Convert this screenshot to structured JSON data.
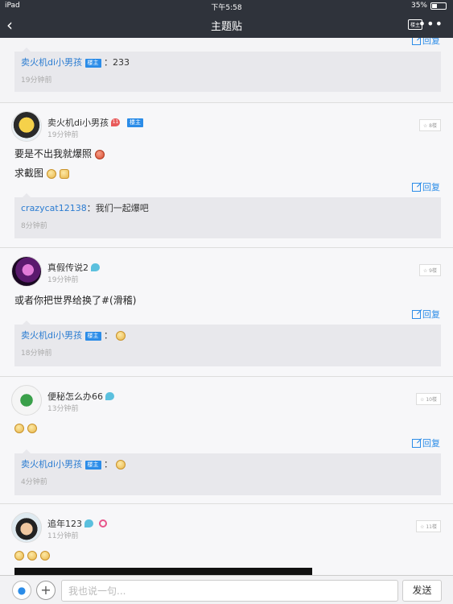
{
  "status": {
    "device": "iPad",
    "time": "下午5:58",
    "battery": "35%"
  },
  "nav": {
    "title": "主题贴",
    "louzhu": "楼主",
    "more": "•••",
    "back": "‹"
  },
  "reply_label": "回复",
  "top_sub": {
    "user": "卖火机di小男孩",
    "badge": "楼主",
    "text": "：233",
    "time": "19分钟前"
  },
  "posts": [
    {
      "user": "卖火机di小男孩",
      "level": "11",
      "badge": "楼主",
      "time": "19分钟前",
      "floor": "8楼",
      "lines": [
        "要是不出我就爆照",
        "求截图"
      ],
      "sub": {
        "user": "crazycat12138",
        "text": "：我们一起爆吧",
        "time": "8分钟前"
      }
    },
    {
      "user": "真假传说2",
      "level": "",
      "time": "19分钟前",
      "floor": "9楼",
      "lines": [
        "或者你把世界给换了#(滑稽)"
      ],
      "sub": {
        "user": "卖火机di小男孩",
        "badge": "楼主",
        "text": "：",
        "time": "18分钟前"
      }
    },
    {
      "user": "便秘怎么办66",
      "level": "",
      "time": "13分钟前",
      "floor": "10楼",
      "lines": [
        ""
      ],
      "sub": {
        "user": "卖火机di小男孩",
        "badge": "楼主",
        "text": "：",
        "time": "4分钟前"
      }
    },
    {
      "user": "追年123",
      "level": "",
      "time": "11分钟前",
      "floor": "11楼",
      "lines": [
        ""
      ]
    }
  ],
  "input": {
    "placeholder": "我也说一句...",
    "send": "发送"
  }
}
